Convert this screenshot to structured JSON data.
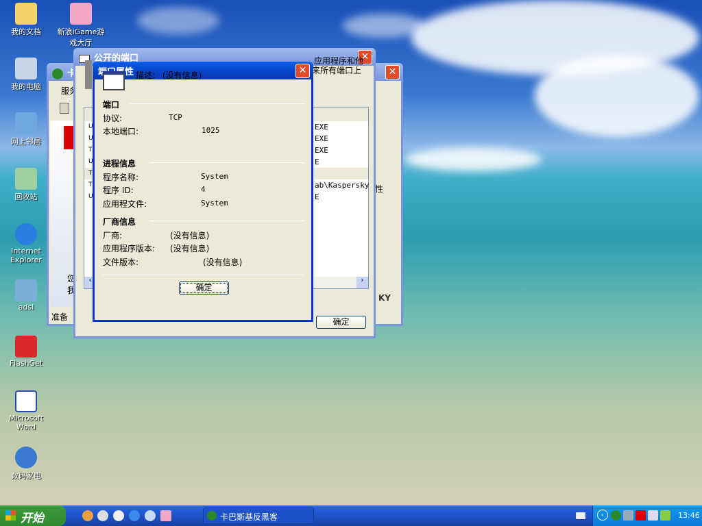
{
  "desktop": {
    "icons": [
      "我的文档",
      "新浪iGame游戏大厅",
      "我的电脑",
      "网上邻居",
      "回收站",
      "Internet Explorer",
      "adsl",
      "FlashGet",
      "Microsoft Word",
      "数码家电"
    ]
  },
  "back_window": {
    "title": "卡",
    "menu": "服务",
    "status": "准备",
    "side_text": "您\n我",
    "right_text": "性",
    "logo_text": "KY"
  },
  "ports_window": {
    "title": "公开的端口",
    "desc_line1": "应用程序和他",
    "desc_line2": "来所有端口上",
    "rows": [
      {
        "proto": "UD",
        "exe": "EXE"
      },
      {
        "proto": "UD",
        "exe": "EXE"
      },
      {
        "proto": "TO",
        "exe": "EXE"
      },
      {
        "proto": "UD",
        "exe": "E"
      },
      {
        "proto": "TO",
        "exe": ""
      },
      {
        "proto": "TO",
        "exe": "ab\\Kaspersky"
      },
      {
        "proto": "UD",
        "exe": "E"
      }
    ],
    "ok_label": "确定"
  },
  "dialog": {
    "title": "端口属性",
    "desc_label": "描述:",
    "desc_value": "(没有信息)",
    "port_section": "端口",
    "protocol_label": "协议:",
    "protocol_value": "TCP",
    "local_port_label": "本地端口:",
    "local_port_value": "1025",
    "process_section": "进程信息",
    "program_name_label": "程序名称:",
    "program_name_value": "System",
    "pid_label": "程序 ID:",
    "pid_value": "4",
    "app_file_label": "应用程文件:",
    "app_file_value": "System",
    "vendor_section": "厂商信息",
    "vendor_label": "厂商:",
    "vendor_value": "(没有信息)",
    "app_version_label": "应用程序版本:",
    "app_version_value": "(没有信息)",
    "file_version_label": "文件版本:",
    "file_version_value": "(没有信息)",
    "ok_label": "确定"
  },
  "taskbar": {
    "start_label": "开始",
    "task_label": "卡巴斯基反黑客",
    "clock": "13:46"
  }
}
